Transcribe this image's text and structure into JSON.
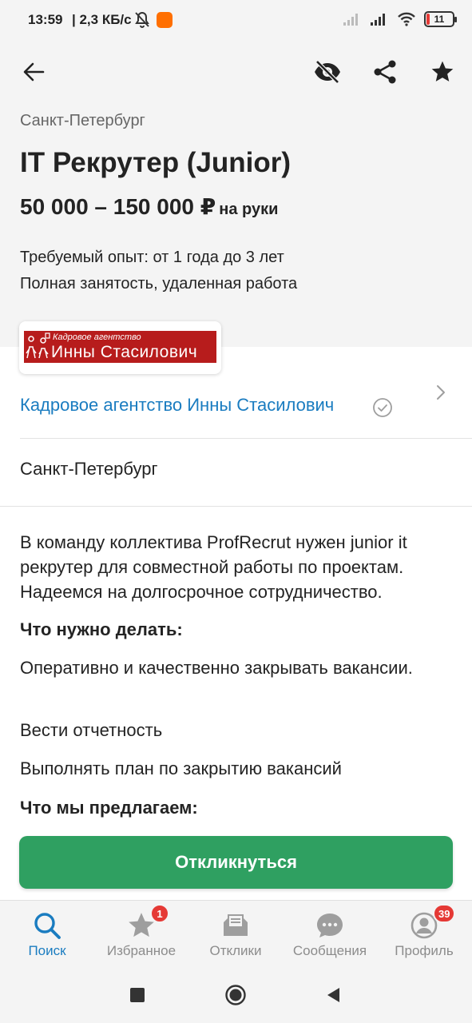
{
  "status_bar": {
    "time": "13:59",
    "speed": "| 2,3 КБ/с",
    "battery": "11",
    "colors": {
      "battery_low": "#e53935",
      "app_notification": "#ff6f00"
    }
  },
  "toolbar": {
    "back_icon": "arrow-left-icon",
    "hide_icon": "eye-off-icon",
    "share_icon": "share-icon",
    "favorite_icon": "star-icon"
  },
  "vacancy": {
    "city": "Санкт-Петербург",
    "title": "IT Рекрутер (Junior)",
    "salary": "50 000 – 150 000 ₽",
    "salary_note": "на руки",
    "experience": "Требуемый опыт: от 1 года до 3 лет",
    "employment": "Полная занятость, удаленная работа"
  },
  "company": {
    "logo_small": "Кадровое агентство",
    "logo_big": "Инны Стасилович",
    "name": "Кадровое агентство Инны Стасилович",
    "address_city": "Санкт-Петербург",
    "logo_color": "#b71c1c"
  },
  "description": {
    "intro": "В команду коллектива ProfRecrut нужен junior it рекрутер для совместной работы по проектам. Надеемся на долгосрочное сотрудничество.",
    "todo_heading": "Что нужно делать:",
    "todo_items": [
      "Оперативно и качественно закрывать вакансии.",
      "Вести отчетность",
      "Выполнять план по закрытию вакансий"
    ],
    "offer_heading": "Что мы предлагаем:"
  },
  "actions": {
    "apply_label": "Откликнуться",
    "apply_color": "#2fa061"
  },
  "tabs": [
    {
      "label": "Поиск",
      "icon": "search-icon",
      "active": true
    },
    {
      "label": "Избранное",
      "icon": "star-icon",
      "badge": "1"
    },
    {
      "label": "Отклики",
      "icon": "envelope-icon"
    },
    {
      "label": "Сообщения",
      "icon": "chat-icon"
    },
    {
      "label": "Профиль",
      "icon": "profile-icon",
      "badge": "39"
    }
  ],
  "system_nav": {
    "recents_icon": "square-icon",
    "home_icon": "circle-icon",
    "back_icon": "triangle-back-icon"
  }
}
